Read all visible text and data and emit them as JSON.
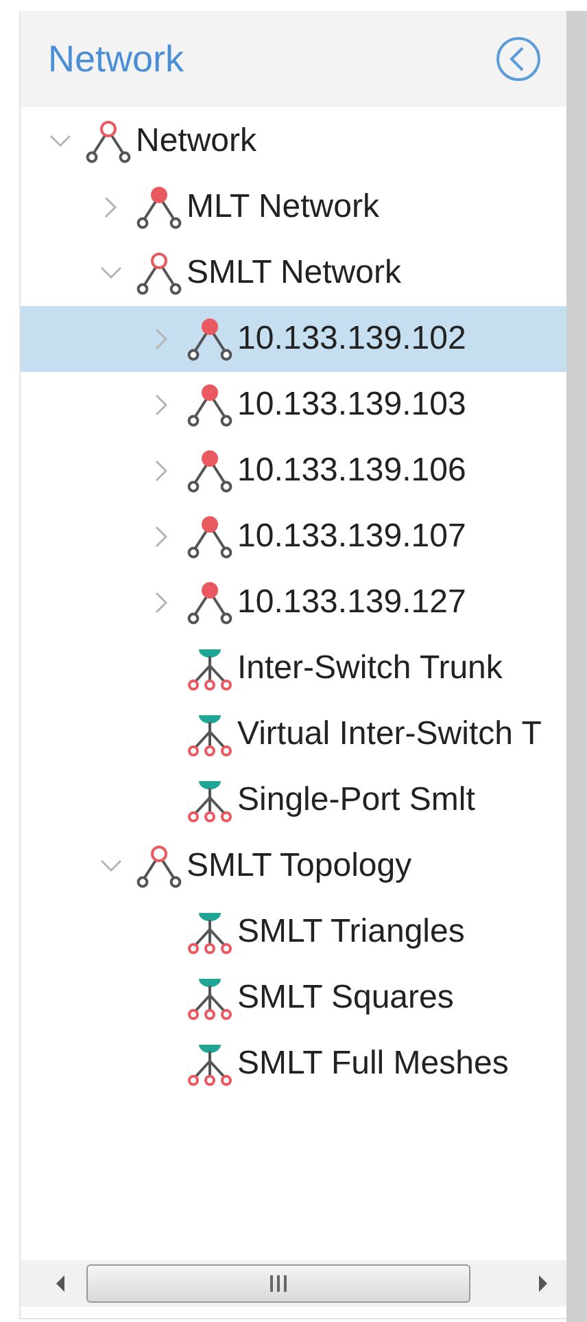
{
  "header": {
    "title": "Network"
  },
  "tree": [
    {
      "label": "Network",
      "kind": "group",
      "expanded": true,
      "selected": false,
      "children": [
        {
          "label": "MLT Network",
          "kind": "group",
          "expanded": false,
          "selected": false
        },
        {
          "label": "SMLT Network",
          "kind": "group",
          "expanded": true,
          "selected": false,
          "children": [
            {
              "label": "10.133.139.102",
              "kind": "group",
              "expanded": false,
              "selected": true
            },
            {
              "label": "10.133.139.103",
              "kind": "group",
              "expanded": false,
              "selected": false
            },
            {
              "label": "10.133.139.106",
              "kind": "group",
              "expanded": false,
              "selected": false
            },
            {
              "label": "10.133.139.107",
              "kind": "group",
              "expanded": false,
              "selected": false
            },
            {
              "label": "10.133.139.127",
              "kind": "group",
              "expanded": false,
              "selected": false
            },
            {
              "label": "Inter-Switch Trunk",
              "kind": "trunk",
              "selected": false
            },
            {
              "label": "Virtual Inter-Switch T",
              "kind": "trunk",
              "selected": false
            },
            {
              "label": "Single-Port Smlt",
              "kind": "trunk",
              "selected": false
            }
          ]
        },
        {
          "label": "SMLT Topology",
          "kind": "group",
          "expanded": true,
          "selected": false,
          "children": [
            {
              "label": "SMLT Triangles",
              "kind": "trunk",
              "selected": false
            },
            {
              "label": "SMLT Squares",
              "kind": "trunk",
              "selected": false
            },
            {
              "label": "SMLT Full Meshes",
              "kind": "trunk",
              "selected": false
            }
          ]
        }
      ]
    }
  ]
}
